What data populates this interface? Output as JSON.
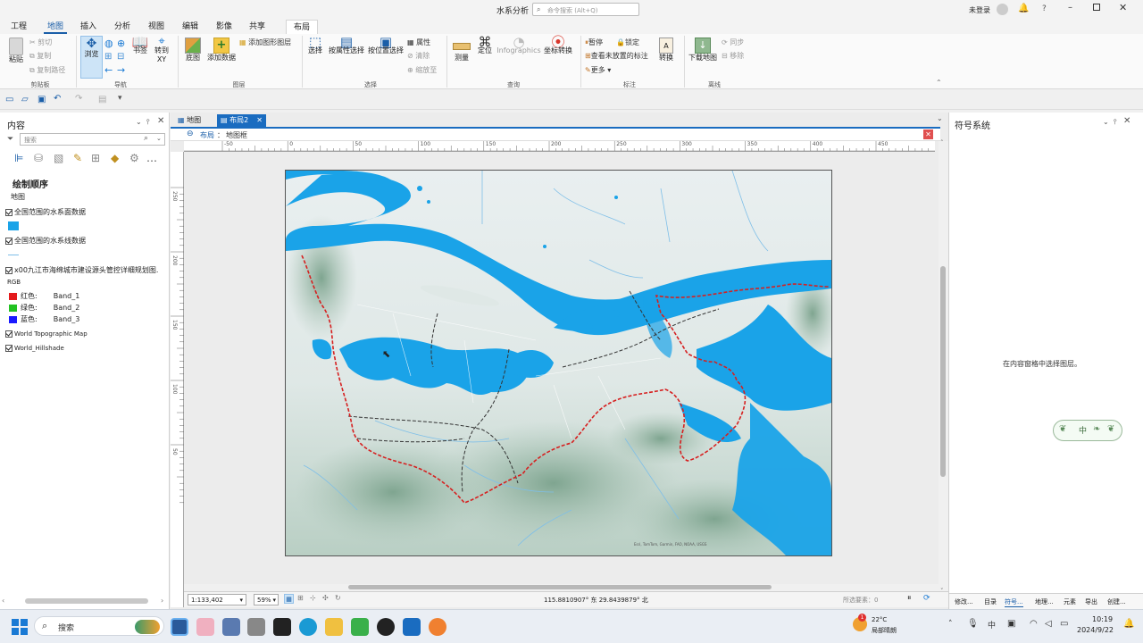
{
  "window": {
    "title": "水系分析",
    "search_placeholder": "命令搜索 (Alt+Q)",
    "user": "未登录"
  },
  "ribbon_tabs": [
    "工程",
    "地图",
    "插入",
    "分析",
    "视图",
    "编辑",
    "影像",
    "共享"
  ],
  "ribbon_active_tab": "地图",
  "ribbon_context_tab": "布局",
  "ribbon": {
    "clipboard": {
      "paste": "粘贴",
      "cut": "剪切",
      "copy": "复制",
      "copy_path": "复制路径",
      "group": "剪贴板"
    },
    "navigate": {
      "explore": "浏览",
      "bookmarks": "书签",
      "goto": "转到\nXY",
      "group": "导航"
    },
    "layer": {
      "basemap": "底图",
      "add_data": "添加数据",
      "add_graphics": "添加图形图层",
      "group": "图层"
    },
    "selection": {
      "select": "选择",
      "by_attr": "按属性选择",
      "by_loc": "按位置选择",
      "attributes": "属性",
      "clear": "清除",
      "zoom_to": "缩放至",
      "group": "选择"
    },
    "inquiry": {
      "measure": "测量",
      "locate": "定位",
      "infographics": "Infographics",
      "coord": "坐标转换",
      "group": "查询"
    },
    "labeling": {
      "pause": "暂停",
      "lock": "锁定",
      "view_unplaced": "查看未放置的标注",
      "more": "更多",
      "convert": "转换",
      "group": "标注"
    },
    "offline": {
      "download": "下载地图",
      "sync": "同步",
      "remove": "移除",
      "group": "离线"
    }
  },
  "contents": {
    "title": "内容",
    "search_placeholder": "搜索",
    "drawing_order": "绘制顺序",
    "map": "地图",
    "layers": [
      {
        "name": "全国范围的水系面数据",
        "checked": true,
        "symbol": "fill",
        "color": "#1aa3e8"
      },
      {
        "name": "全国范围的水系线数据",
        "checked": true,
        "symbol": "line",
        "color": "#7fbfe8"
      },
      {
        "name": "x00九江市海绵城市建设源头管控详细规划图.",
        "checked": true,
        "symbol": "rgb"
      },
      {
        "name": "World Topographic Map",
        "checked": true
      },
      {
        "name": "World_Hillshade",
        "checked": true
      }
    ],
    "rgb_label": "RGB",
    "bands": [
      {
        "name": "红色:",
        "band": "Band_1",
        "color": "#e41a1c"
      },
      {
        "name": "绿色:",
        "band": "Band_2",
        "color": "#22c222"
      },
      {
        "name": "蓝色:",
        "band": "Band_3",
        "color": "#1a1aff"
      }
    ]
  },
  "view_tabs": [
    {
      "label": "地图",
      "active": false
    },
    {
      "label": "布局2",
      "active": true
    }
  ],
  "layout_breadcrumb": {
    "back": "布局",
    "item": "地图框"
  },
  "ruler_h": [
    "-50",
    "0",
    "50",
    "100",
    "150",
    "200",
    "250",
    "300",
    "350",
    "400",
    "450"
  ],
  "ruler_v": [
    "250",
    "200",
    "150",
    "100",
    "50"
  ],
  "status": {
    "scale": "1:133,402",
    "zoom": "59%",
    "coords": "115.8810907° 东 29.8439879° 北",
    "selected": "所选要素：0"
  },
  "symbology": {
    "title": "符号系统",
    "message": "在内容窗格中选择图层。",
    "input_text": "中"
  },
  "right_tabs": [
    "修改...",
    "目录",
    "符号...",
    "地理...",
    "元素",
    "导出",
    "创建..."
  ],
  "taskbar": {
    "search": "搜索",
    "weather_temp": "22°C",
    "weather_desc": "局部晴朗",
    "time": "10:19",
    "date": "2024/9/22",
    "weather_badge": "1"
  }
}
